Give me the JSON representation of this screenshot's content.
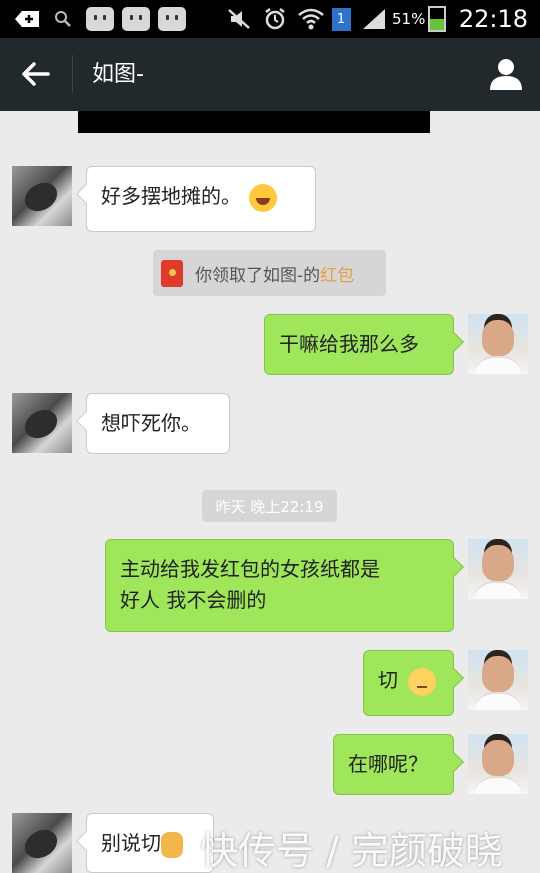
{
  "status_bar": {
    "battery": "51%",
    "time": "22:18",
    "notification_count": "1"
  },
  "header": {
    "title": "如图-"
  },
  "messages": [
    {
      "sender": "other",
      "text": "好多摆地摊的。",
      "emoji": "laughing-tears"
    },
    {
      "type": "system",
      "text": "你领取了如图-的",
      "link": "红包"
    },
    {
      "sender": "me",
      "text": "干嘛给我那么多"
    },
    {
      "sender": "other",
      "text": "想吓死你。"
    },
    {
      "type": "timestamp",
      "text": "昨天 晚上22:19"
    },
    {
      "sender": "me",
      "line1": "主动给我发红包的女孩纸都是",
      "line2": "好人 我不会删的"
    },
    {
      "sender": "me",
      "text": "切",
      "emoji": "unamused"
    },
    {
      "sender": "me",
      "text": "在哪呢？"
    },
    {
      "sender": "other",
      "text": "别说切",
      "emoji": "waving-hand"
    }
  ],
  "watermark": "快传号 / 完颜破晓"
}
